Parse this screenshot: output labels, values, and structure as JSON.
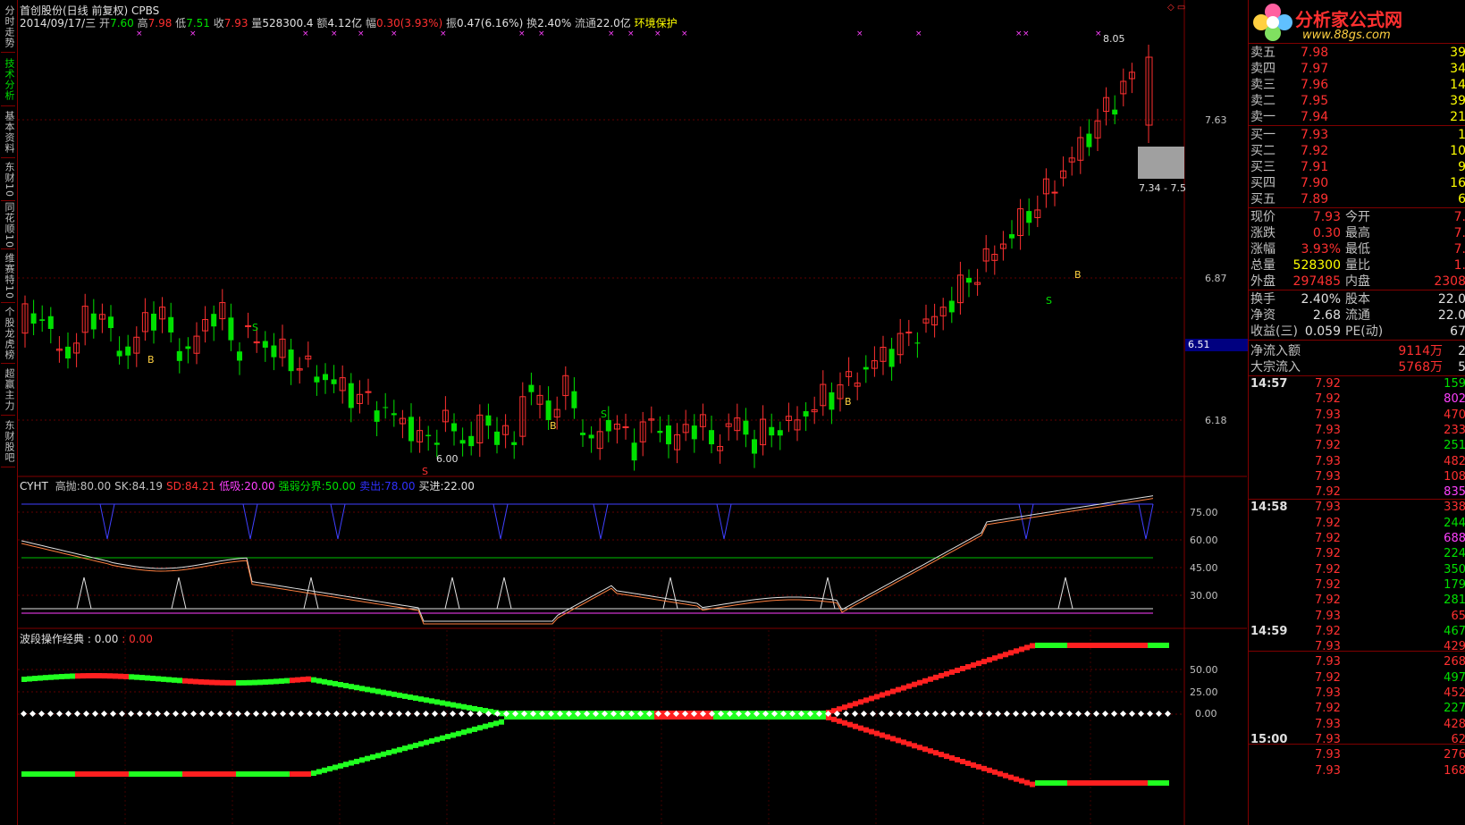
{
  "left_tabs": [
    {
      "label": "分时走势",
      "active": false
    },
    {
      "label": "技术分析",
      "active": true
    },
    {
      "label": "基本资料",
      "active": false
    },
    {
      "label": "东财10",
      "active": false
    },
    {
      "label": "同花顺10",
      "active": false
    },
    {
      "label": "维赛特10",
      "active": false
    },
    {
      "label": "个股龙虎榜",
      "active": false
    },
    {
      "label": "超赢主力",
      "active": false
    },
    {
      "label": "东财股吧",
      "active": false
    }
  ],
  "header": {
    "stock_line": "首创股份(日线 前复权) CPBS",
    "date": "2014/09/17/三",
    "open_label": "开",
    "open": "7.60",
    "high_label": "高",
    "high": "7.98",
    "low_label": "低",
    "low": "7.51",
    "close_label": "收",
    "close": "7.93",
    "vol_label": "量",
    "vol": "528300.4",
    "amt_label": "额",
    "amt": "4.12亿",
    "chg_label": "幅",
    "chg": "0.30(3.93%)",
    "amp_label": "振",
    "amp": "0.47(6.16%)",
    "turn_label": "换",
    "turn": "2.40%",
    "float_label": "流通",
    "float": "22.0亿",
    "sector": "环境保护"
  },
  "price_axis": {
    "ticks": [
      "7.63",
      "6.87",
      "6.18"
    ],
    "current": "6.51"
  },
  "annotations": {
    "high": "8.05",
    "low": "6.00",
    "range_box": "7.34 - 7.5",
    "buy": "B",
    "sell": "S"
  },
  "indicator1": {
    "name": "CYHT",
    "params": [
      {
        "label": "高抛:",
        "value": "80.00",
        "color": "#c0c0c0"
      },
      {
        "label": "SK:",
        "value": "84.19",
        "color": "#c0c0c0"
      },
      {
        "label": "SD:",
        "value": "84.21",
        "color": "#ff3030"
      },
      {
        "label": "低吸:",
        "value": "20.00",
        "color": "#ff40ff"
      },
      {
        "label": "强弱分界:",
        "value": "50.00",
        "color": "#00e000"
      },
      {
        "label": "卖出:",
        "value": "78.00",
        "color": "#3030ff"
      },
      {
        "label": "买进:",
        "value": "22.00",
        "color": "#e0e0e0"
      }
    ],
    "ticks": [
      "75.00",
      "60.00",
      "45.00",
      "30.00"
    ]
  },
  "indicator2": {
    "name": "波段操作经典",
    "v1": ": 0.00",
    "v2": ": 0.00",
    "ticks": [
      "50.00",
      "25.00",
      "0.00"
    ]
  },
  "logo": {
    "brand": "分析家公式网",
    "url": "www.88gs.com"
  },
  "order_book": {
    "asks": [
      {
        "label": "卖五",
        "price": "7.98",
        "vol": "39"
      },
      {
        "label": "卖四",
        "price": "7.97",
        "vol": "34"
      },
      {
        "label": "卖三",
        "price": "7.96",
        "vol": "14"
      },
      {
        "label": "卖二",
        "price": "7.95",
        "vol": "39"
      },
      {
        "label": "卖一",
        "price": "7.94",
        "vol": "21"
      }
    ],
    "bids": [
      {
        "label": "买一",
        "price": "7.93",
        "vol": "1"
      },
      {
        "label": "买二",
        "price": "7.92",
        "vol": "10"
      },
      {
        "label": "买三",
        "price": "7.91",
        "vol": "9"
      },
      {
        "label": "买四",
        "price": "7.90",
        "vol": "16"
      },
      {
        "label": "买五",
        "price": "7.89",
        "vol": "6"
      }
    ]
  },
  "stats": [
    {
      "l1": "现价",
      "v1": "7.93",
      "c1": "red",
      "l2": "今开",
      "v2": "7."
    },
    {
      "l1": "涨跌",
      "v1": "0.30",
      "c1": "red",
      "l2": "最高",
      "v2": "7."
    },
    {
      "l1": "涨幅",
      "v1": "3.93%",
      "c1": "red",
      "l2": "最低",
      "v2": "7."
    },
    {
      "l1": "总量",
      "v1": "528300",
      "c1": "yel",
      "l2": "量比",
      "v2": "1."
    },
    {
      "l1": "外盘",
      "v1": "297485",
      "c1": "red",
      "l2": "内盘",
      "v2": "2308"
    }
  ],
  "stats2": [
    {
      "l1": "换手",
      "v1": "2.40%",
      "l2": "股本",
      "v2": "22.0"
    },
    {
      "l1": "净资",
      "v1": "2.68",
      "l2": "流通",
      "v2": "22.0"
    },
    {
      "l1": "收益(三)",
      "v1": "0.059",
      "l2": "PE(动)",
      "v2": "67"
    }
  ],
  "flow": [
    {
      "label": "净流入额",
      "value": "9114万",
      "extra": "2"
    },
    {
      "label": "大宗流入",
      "value": "5768万",
      "extra": "5"
    }
  ],
  "ticks_table": [
    {
      "time": "14:57",
      "price": "7.92",
      "vol": "159",
      "vc": "grn"
    },
    {
      "time": "",
      "price": "7.92",
      "vol": "802",
      "vc": "mag"
    },
    {
      "time": "",
      "price": "7.93",
      "vol": "470",
      "vc": "red"
    },
    {
      "time": "",
      "price": "7.93",
      "vol": "233",
      "vc": "red"
    },
    {
      "time": "",
      "price": "7.92",
      "vol": "251",
      "vc": "grn"
    },
    {
      "time": "",
      "price": "7.93",
      "vol": "482",
      "vc": "red"
    },
    {
      "time": "",
      "price": "7.93",
      "vol": "108",
      "vc": "red"
    },
    {
      "time": "",
      "price": "7.92",
      "vol": "835",
      "vc": "mag"
    },
    {
      "time": "14:58",
      "price": "7.93",
      "vol": "338",
      "vc": "red"
    },
    {
      "time": "",
      "price": "7.92",
      "vol": "244",
      "vc": "grn"
    },
    {
      "time": "",
      "price": "7.92",
      "vol": "688",
      "vc": "mag"
    },
    {
      "time": "",
      "price": "7.92",
      "vol": "224",
      "vc": "grn"
    },
    {
      "time": "",
      "price": "7.92",
      "vol": "350",
      "vc": "grn"
    },
    {
      "time": "",
      "price": "7.92",
      "vol": "179",
      "vc": "grn"
    },
    {
      "time": "",
      "price": "7.92",
      "vol": "281",
      "vc": "grn"
    },
    {
      "time": "",
      "price": "7.93",
      "vol": "65",
      "vc": "red"
    },
    {
      "time": "14:59",
      "price": "7.92",
      "vol": "467",
      "vc": "grn"
    },
    {
      "time": "",
      "price": "7.93",
      "vol": "429",
      "vc": "red"
    },
    {
      "time": "",
      "price": "7.93",
      "vol": "268",
      "vc": "red"
    },
    {
      "time": "",
      "price": "7.92",
      "vol": "497",
      "vc": "grn"
    },
    {
      "time": "",
      "price": "7.93",
      "vol": "452",
      "vc": "red"
    },
    {
      "time": "",
      "price": "7.92",
      "vol": "227",
      "vc": "grn"
    },
    {
      "time": "",
      "price": "7.93",
      "vol": "428",
      "vc": "red"
    },
    {
      "time": "15:00",
      "price": "7.93",
      "vol": "62",
      "vc": "red"
    },
    {
      "time": "",
      "price": "7.93",
      "vol": "276",
      "vc": "red"
    },
    {
      "time": "",
      "price": "7.93",
      "vol": "168",
      "vc": "red"
    }
  ]
}
